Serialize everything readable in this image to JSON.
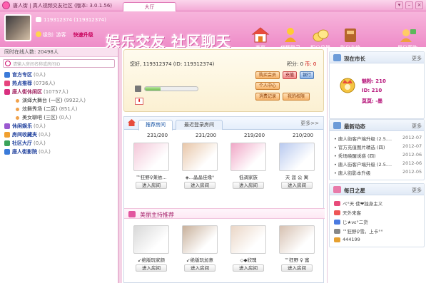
{
  "window": {
    "title": "唐人街 | 真人视频交友社区 (版本: 3.0.1.56)",
    "tab_label": "大厅",
    "controls": [
      "▾",
      "–",
      "×"
    ]
  },
  "user": {
    "id_line": "119312374 (119312374)",
    "level_label": "级别: 游客",
    "upgrade_label": "快速升级",
    "greeting": "您好, 119312374 (ID: 119312374)",
    "points": "积分: 0",
    "coins": "币: 0",
    "progress": 0.3
  },
  "banner": {
    "slogan": "娱乐交友 社区聊天"
  },
  "nav": [
    {
      "label": "首页",
      "color": "#ffffff"
    },
    {
      "label": "代理登录",
      "color": "#ffcc33"
    },
    {
      "label": "积分兑换",
      "color": "#ffd966"
    },
    {
      "label": "账户充值",
      "color": "#d9a060"
    },
    {
      "label": "用户帮助",
      "color": "#ffcc66"
    }
  ],
  "user_buttons": {
    "buy_member": "购买会员",
    "recharge": "充值",
    "bank": "银行",
    "personal_center": "个人中心",
    "consume_record": "消费记录",
    "my_rights": "我的权限"
  },
  "sidebar": {
    "online": "同时在线人数: 20498人",
    "search_placeholder": "请输入房间名称或房间ID",
    "items": [
      {
        "name": "官方专区",
        "count": "(0人)",
        "type": "top",
        "icon_color": "#3a7ad9"
      },
      {
        "name": "热点推荐",
        "count": "(0736人)",
        "type": "top",
        "icon_color": "#e6447d"
      },
      {
        "name": "唐人街休闲区",
        "count": "(10757人)",
        "type": "root",
        "icon_color": "#d9307f"
      },
      {
        "name": "演绎大舞台 (一区)",
        "count": "(9922人)",
        "type": "sub"
      },
      {
        "name": "炫舞秀场 (二区)",
        "count": "(851人)",
        "type": "sub"
      },
      {
        "name": "美女聊吧 (三区)",
        "count": "(0人)",
        "type": "sub"
      },
      {
        "name": "休闲娱乐",
        "count": "(0人)",
        "type": "top",
        "icon_color": "#9b59d0"
      },
      {
        "name": "房间收藏夹",
        "count": "(0人)",
        "type": "top",
        "icon_color": "#f0a030"
      },
      {
        "name": "社区大厅",
        "count": "(0人)",
        "type": "top",
        "icon_color": "#3aa35a"
      },
      {
        "name": "唐人街影院",
        "count": "(0人)",
        "type": "top",
        "icon_color": "#3a7ad9"
      }
    ]
  },
  "tabs": {
    "recommended": "推荐房间",
    "recent": "最近登录房间",
    "more": "更多>>"
  },
  "rooms": [
    {
      "count": "231/200",
      "name": "™狂野♀莱依...",
      "enter": "进入房间",
      "pic_color": "#f3c7d8"
    },
    {
      "count": "231/200",
      "name": "◈...晶晶佳缘°",
      "enter": "进入房间",
      "pic_color": "#e8c6a8"
    },
    {
      "count": "219/200",
      "name": "低调家族",
      "enter": "进入房间",
      "pic_color": "#f0a7c6"
    },
    {
      "count": "210/200",
      "name": "天 涯 公 寓",
      "enter": "进入房间",
      "pic_color": "#b8c9ef"
    }
  ],
  "hosts_section": {
    "title": "美丽主持推荐",
    "hosts": [
      {
        "name": "↙绝版玩家颜 ",
        "enter": "进入房间",
        "pic_color": "#d8d8d8"
      },
      {
        "name": "↙绝版玩加意 ",
        "enter": "进入房间",
        "pic_color": "#c8b09a"
      },
      {
        "name": "◇◆欣瑰",
        "enter": "进入房间",
        "pic_color": "#ead6c6"
      },
      {
        "name": "™狂野 ♀ 富",
        "enter": "进入房间",
        "pic_color": "#d6c0b0"
      }
    ]
  },
  "right": {
    "mayor": {
      "title": "现在市长",
      "more": "更多",
      "charm": "魅粉: 210",
      "id": "ID: 210",
      "name": "莫莫: -墨"
    },
    "news": {
      "title": "最新动态",
      "more": "更多",
      "items": [
        {
          "text": "唐人街客户端升级 (2.5....",
          "date": "2012-07"
        },
        {
          "text": "官方充值图片精选 (四)",
          "date": "2012-07"
        },
        {
          "text": "秀场唤醒诱惑 (四)",
          "date": "2012-06"
        },
        {
          "text": "唐人街客户端升级 (2.5....",
          "date": "2012-06"
        },
        {
          "text": "唐人街影本升级",
          "date": "2012-05"
        }
      ]
    },
    "stars": {
      "title": "每日之星",
      "more": "更多",
      "items": [
        {
          "text": "ペ°天 使❤独身主义",
          "color": "#e84b7a"
        },
        {
          "text": "天外来客",
          "color": "#e55"
        },
        {
          "text": "じ★νε°二货",
          "color": "#4a7ae0"
        },
        {
          "text": "™狂野♀雪。上卡°°",
          "color": "#888"
        },
        {
          "text": "444199",
          "color": "#e6a030"
        }
      ]
    }
  }
}
